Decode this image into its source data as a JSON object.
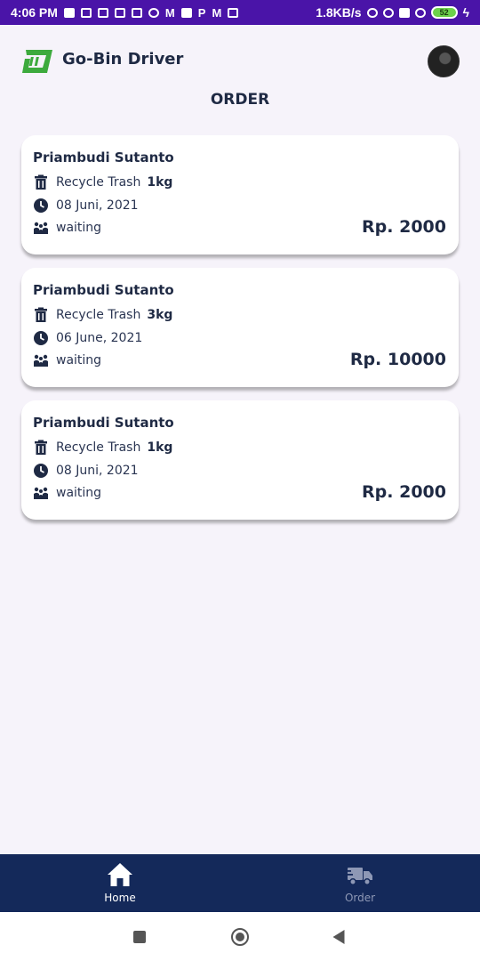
{
  "status_bar": {
    "time": "4:06 PM",
    "network_speed": "1.8KB/s",
    "battery": "52",
    "notification_letters": [
      "M",
      "P",
      "M"
    ]
  },
  "header": {
    "app_title": "Go-Bin Driver",
    "page_title": "ORDER",
    "brand_color": "#3daa3d"
  },
  "orders": [
    {
      "customer": "Priambudi Sutanto",
      "service": "Recycle Trash",
      "weight": "1kg",
      "date": "08 Juni, 2021",
      "status": "waiting",
      "price": "Rp. 2000"
    },
    {
      "customer": "Priambudi Sutanto",
      "service": "Recycle Trash",
      "weight": "3kg",
      "date": "06 June, 2021",
      "status": "waiting",
      "price": "Rp. 10000"
    },
    {
      "customer": "Priambudi Sutanto",
      "service": "Recycle Trash",
      "weight": "1kg",
      "date": "08 Juni, 2021",
      "status": "waiting",
      "price": "Rp. 2000"
    }
  ],
  "bottom_nav": {
    "background": "#14295a",
    "items": [
      {
        "label": "Home",
        "icon": "home-icon",
        "active": true
      },
      {
        "label": "Order",
        "icon": "truck-icon",
        "active": false
      }
    ]
  }
}
